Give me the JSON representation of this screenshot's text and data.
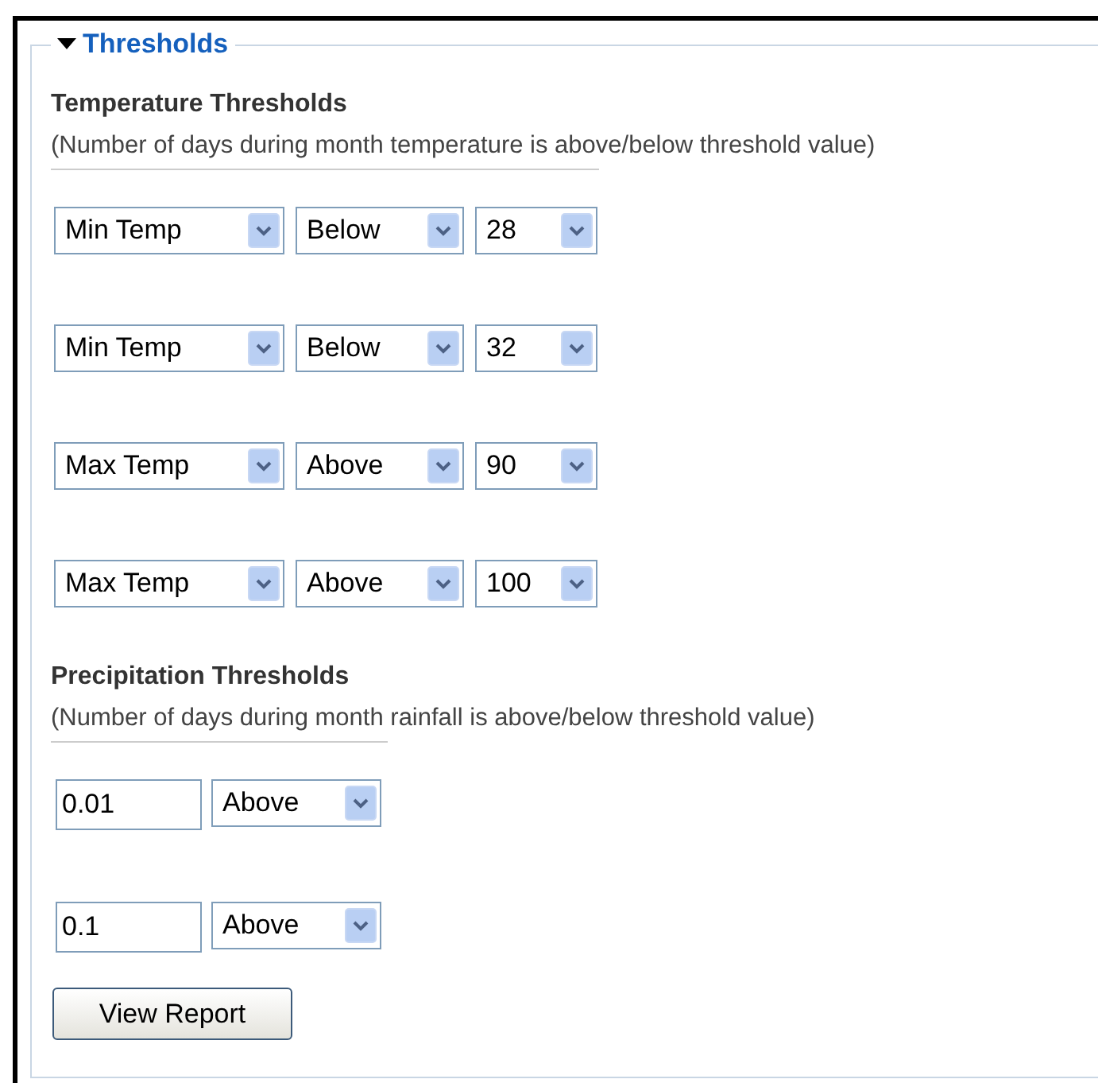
{
  "section": {
    "title": "Thresholds",
    "expanded": true
  },
  "temperature": {
    "heading": "Temperature Thresholds",
    "note": "(Number of days during month temperature is above/below threshold value)",
    "rows": [
      {
        "variable": "Min Temp",
        "comparison": "Below",
        "value": "28"
      },
      {
        "variable": "Min Temp",
        "comparison": "Below",
        "value": "32"
      },
      {
        "variable": "Max Temp",
        "comparison": "Above",
        "value": "90"
      },
      {
        "variable": "Max Temp",
        "comparison": "Above",
        "value": "100"
      }
    ]
  },
  "precipitation": {
    "heading": "Precipitation Thresholds",
    "note": "(Number of days during month rainfall is above/below threshold value)",
    "rows": [
      {
        "amount": "0.01",
        "comparison": "Above"
      },
      {
        "amount": "0.1",
        "comparison": "Above"
      }
    ]
  },
  "button": "View Report"
}
